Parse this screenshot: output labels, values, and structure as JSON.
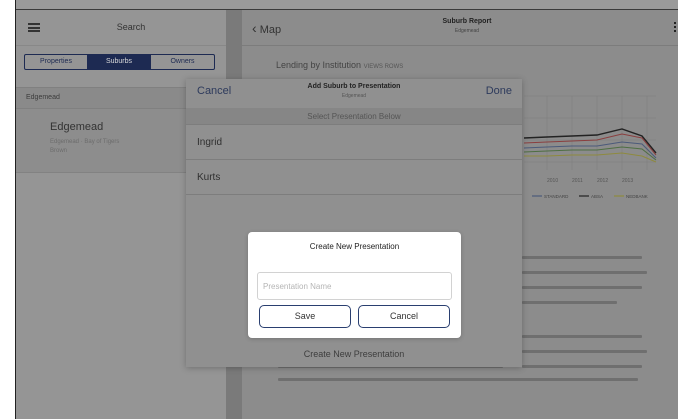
{
  "sidebar": {
    "title": "Search",
    "segments": [
      {
        "label": "Properties",
        "active": false
      },
      {
        "label": "Suburbs",
        "active": true
      },
      {
        "label": "Owners",
        "active": false
      }
    ],
    "section_label": "Edgemead",
    "selected_item": {
      "title": "Edgemead",
      "subtitle": "Edgemead · Bay of Tigers Brown"
    }
  },
  "main": {
    "back_label": "Map",
    "report_title": "Suburb Report",
    "report_subtitle": "Edgemead",
    "section_heading": "Lending by Institution",
    "section_note": "VIEWS ROWS",
    "chart_x_ticks": [
      "2010",
      "2011",
      "2012",
      "2013"
    ],
    "chart_legend": [
      "STANDARD",
      "ABSA",
      "NEDBANK"
    ]
  },
  "popover": {
    "cancel_label": "Cancel",
    "done_label": "Done",
    "title": "Add Suburb to Presentation",
    "subtitle": "Edgemead",
    "hint": "Select Presentation Below",
    "items": [
      "Ingrid",
      "Kurts"
    ],
    "footer": "Create New Presentation"
  },
  "dialog": {
    "title": "Create New Presentation",
    "input_placeholder": "Presentation Name",
    "input_value": "",
    "save_label": "Save",
    "cancel_label": "Cancel"
  },
  "colors": {
    "navy": "#1d2a52",
    "dim_overlay": "#8c8c8c",
    "dialog_border": "#2a3f70"
  }
}
